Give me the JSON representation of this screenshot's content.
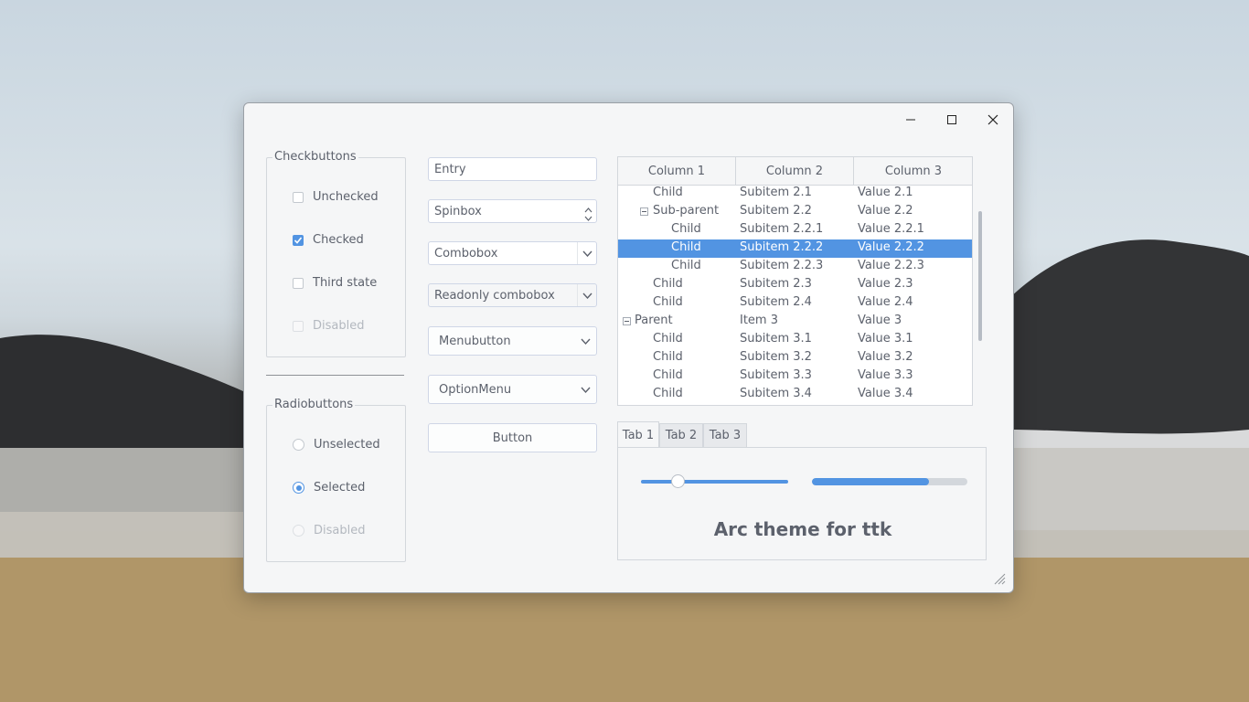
{
  "window": {
    "controls": {
      "minimize": "minimize-icon",
      "maximize": "maximize-icon",
      "close": "close-icon"
    }
  },
  "checkbuttons": {
    "title": "Checkbuttons",
    "items": [
      {
        "label": "Unchecked",
        "state": "unchecked"
      },
      {
        "label": "Checked",
        "state": "checked"
      },
      {
        "label": "Third state",
        "state": "unchecked"
      },
      {
        "label": "Disabled",
        "state": "disabled"
      }
    ]
  },
  "radiobuttons": {
    "title": "Radiobuttons",
    "items": [
      {
        "label": "Unselected",
        "state": "unselected"
      },
      {
        "label": "Selected",
        "state": "selected"
      },
      {
        "label": "Disabled",
        "state": "disabled"
      }
    ]
  },
  "inputs": {
    "entry": "Entry",
    "spinbox": "Spinbox",
    "combobox": "Combobox",
    "readonly_combobox": "Readonly combobox",
    "menubutton": "Menubutton",
    "optionmenu": "OptionMenu",
    "button": "Button"
  },
  "tree": {
    "columns": [
      "Column 1",
      "Column 2",
      "Column 3"
    ],
    "rows": [
      {
        "c1": "Child",
        "c2": "Subitem 2.1",
        "c3": "Value 2.1",
        "level": 1,
        "expander": false,
        "selected": false
      },
      {
        "c1": "Sub-parent",
        "c2": "Subitem 2.2",
        "c3": "Value 2.2",
        "level": 1,
        "expander": true,
        "selected": false
      },
      {
        "c1": "Child",
        "c2": "Subitem 2.2.1",
        "c3": "Value 2.2.1",
        "level": 2,
        "expander": false,
        "selected": false
      },
      {
        "c1": "Child",
        "c2": "Subitem 2.2.2",
        "c3": "Value 2.2.2",
        "level": 2,
        "expander": false,
        "selected": true
      },
      {
        "c1": "Child",
        "c2": "Subitem 2.2.3",
        "c3": "Value 2.2.3",
        "level": 2,
        "expander": false,
        "selected": false
      },
      {
        "c1": "Child",
        "c2": "Subitem 2.3",
        "c3": "Value 2.3",
        "level": 1,
        "expander": false,
        "selected": false
      },
      {
        "c1": "Child",
        "c2": "Subitem 2.4",
        "c3": "Value 2.4",
        "level": 1,
        "expander": false,
        "selected": false
      },
      {
        "c1": "Parent",
        "c2": "Item 3",
        "c3": "Value 3",
        "level": 0,
        "expander": true,
        "selected": false
      },
      {
        "c1": "Child",
        "c2": "Subitem 3.1",
        "c3": "Value 3.1",
        "level": 1,
        "expander": false,
        "selected": false
      },
      {
        "c1": "Child",
        "c2": "Subitem 3.2",
        "c3": "Value 3.2",
        "level": 1,
        "expander": false,
        "selected": false
      },
      {
        "c1": "Child",
        "c2": "Subitem 3.3",
        "c3": "Value 3.3",
        "level": 1,
        "expander": false,
        "selected": false
      },
      {
        "c1": "Child",
        "c2": "Subitem 3.4",
        "c3": "Value 3.4",
        "level": 1,
        "expander": false,
        "selected": false
      }
    ]
  },
  "notebook": {
    "tabs": [
      "Tab 1",
      "Tab 2",
      "Tab 3"
    ],
    "active_tab": 0,
    "scale_value": 0.25,
    "progress_value": 0.75,
    "label": "Arc theme for ttk"
  },
  "colors": {
    "accent": "#5294e2",
    "text": "#5c616c",
    "window_bg": "#f5f6f7"
  }
}
